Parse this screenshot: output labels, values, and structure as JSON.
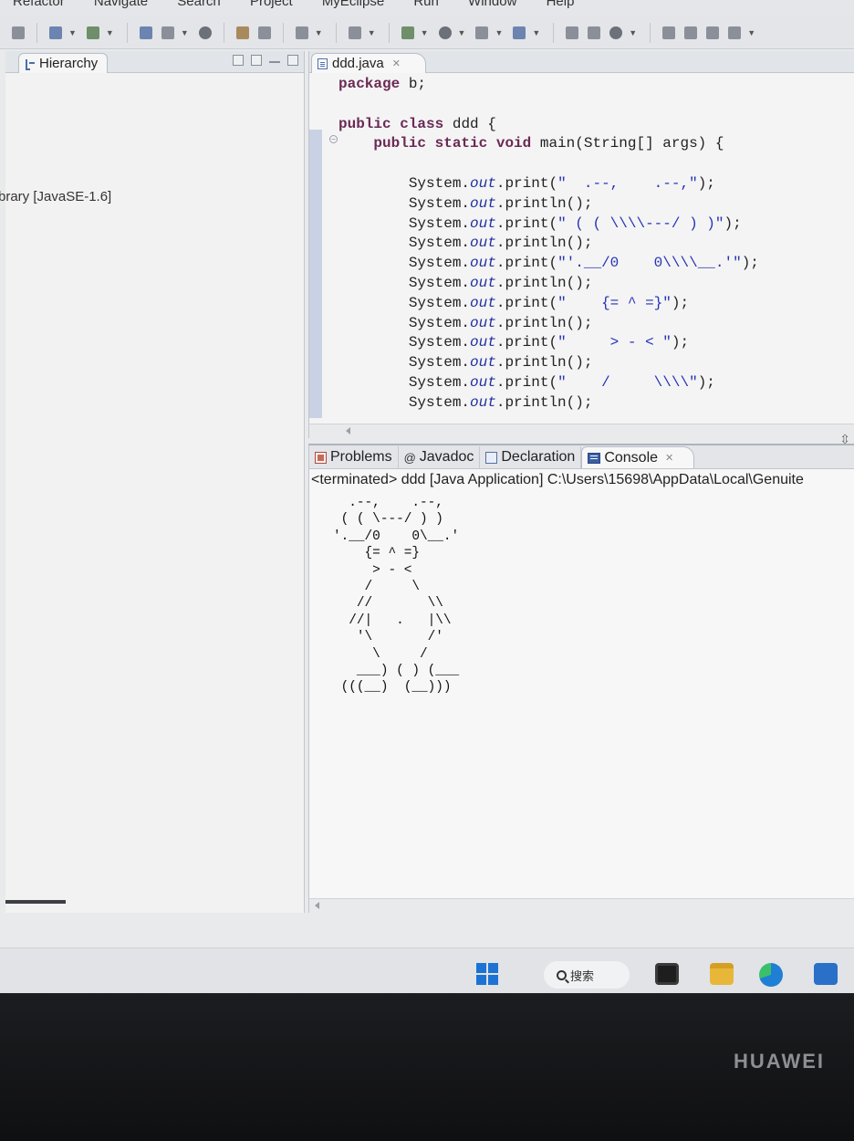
{
  "menubar": {
    "items": [
      "Refactor",
      "Navigate",
      "Search",
      "Project",
      "MyEclipse",
      "Run",
      "Window",
      "Help"
    ]
  },
  "toolbar": {
    "icons": [
      "new-icon",
      "debug-icon",
      "run-icon",
      "server-icon",
      "deploy-icon",
      "browser-icon",
      "java-icon",
      "package-icon",
      "class-icon",
      "search-icon",
      "build-icon"
    ]
  },
  "left_panel": {
    "tab_label": "Hierarchy",
    "tree_item": "brary [JavaSE-1.6]"
  },
  "editor": {
    "tab_label": "ddd.java",
    "close_glyph": "✕"
  },
  "console": {
    "tabs": [
      {
        "label": "Problems",
        "icon": "problems-icon"
      },
      {
        "label": "Javadoc",
        "icon": "javadoc-icon"
      },
      {
        "label": "Declaration",
        "icon": "declaration-icon"
      },
      {
        "label": "Console",
        "icon": "console-icon"
      }
    ],
    "close_glyph": "✕",
    "status": "<terminated> ddd [Java Application] C:\\Users\\15698\\AppData\\Local\\Genuite",
    "output": "  .--,    .--,\n ( ( \\---/ ) )\n'.__/0    0\\__.'\n    {= ^ =}\n     > - <\n    /     \\\n   //       \\\\\n  //|   .   |\\\\\n   '\\       /'\n     \\     /\n   ___) ( ) (___\n (((__)  (__)))"
  },
  "taskbar": {
    "search_label": "搜索"
  },
  "device": {
    "brand": "HUAWEI"
  },
  "colors": {
    "keyword": "#6a2a55",
    "field": "#1f2fa0",
    "string": "#2632b5",
    "start_blue": "#1c73d4"
  }
}
